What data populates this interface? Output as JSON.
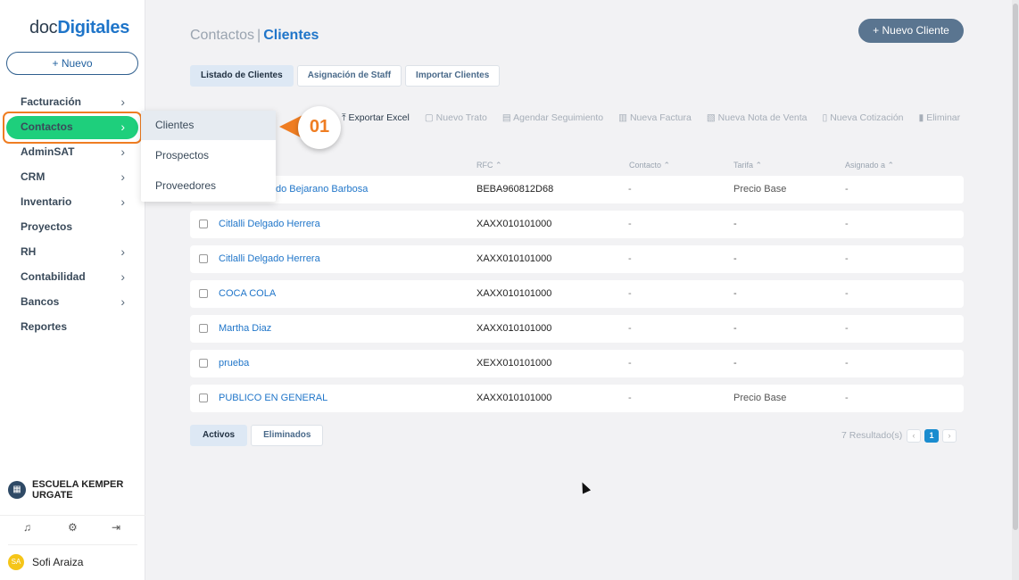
{
  "sidebar": {
    "logo_prefix": "doc",
    "logo_bold": "Digitales",
    "new_button": "+ Nuevo",
    "items": [
      {
        "label": "Facturación",
        "has_chevron": true
      },
      {
        "label": "Contactos",
        "has_chevron": true,
        "active": true
      },
      {
        "label": "AdminSAT",
        "has_chevron": true
      },
      {
        "label": "CRM",
        "has_chevron": true
      },
      {
        "label": "Inventario",
        "has_chevron": true
      },
      {
        "label": "Proyectos",
        "has_chevron": false
      },
      {
        "label": "RH",
        "has_chevron": true
      },
      {
        "label": "Contabilidad",
        "has_chevron": true
      },
      {
        "label": "Bancos",
        "has_chevron": true
      },
      {
        "label": "Reportes",
        "has_chevron": false
      }
    ],
    "chevron": "›",
    "org": {
      "icon": "building-icon",
      "name": "ESCUELA KEMPER URGATE"
    },
    "footer_icons": [
      "bell-icon",
      "gear-icon",
      "logout-icon"
    ],
    "user": {
      "initials": "SA",
      "name": "Sofi Araiza"
    }
  },
  "header": {
    "section": "Contactos",
    "separator": "|",
    "page": "Clientes",
    "new_client_button": "+ Nuevo Cliente"
  },
  "tabs": [
    "Listado de Clientes",
    "Asignación de Staff",
    "Importar Clientes"
  ],
  "toolbar": [
    "⤒ Exportar Excel",
    "▢ Nuevo Trato",
    "▤ Agendar Seguimiento",
    "▥ Nueva Factura",
    "▧ Nueva Nota de Venta",
    "▯ Nueva Cotización",
    "▮ Eliminar"
  ],
  "table": {
    "columns": [
      "RFC ⌃",
      "Contacto ⌃",
      "Tarifa ⌃",
      "Asignado a ⌃"
    ],
    "rows": [
      {
        "name": "do Bejarano Barbosa",
        "rfc": "BEBA960812D68",
        "contacto": "-",
        "tarifa": "Precio Base",
        "asignado": "-"
      },
      {
        "name": "Citlalli Delgado Herrera",
        "rfc": "XAXX010101000",
        "contacto": "-",
        "tarifa": "-",
        "asignado": "-"
      },
      {
        "name": "Citlalli Delgado Herrera",
        "rfc": "XAXX010101000",
        "contacto": "-",
        "tarifa": "-",
        "asignado": "-"
      },
      {
        "name": "COCA COLA",
        "rfc": "XAXX010101000",
        "contacto": "-",
        "tarifa": "-",
        "asignado": "-"
      },
      {
        "name": "Martha Diaz",
        "rfc": "XAXX010101000",
        "contacto": "-",
        "tarifa": "-",
        "asignado": "-"
      },
      {
        "name": "prueba",
        "rfc": "XEXX010101000",
        "contacto": "-",
        "tarifa": "-",
        "asignado": "-"
      },
      {
        "name": "PUBLICO EN GENERAL",
        "rfc": "XAXX010101000",
        "contacto": "-",
        "tarifa": "Precio Base",
        "asignado": "-"
      }
    ]
  },
  "bottom_tabs": [
    "Activos",
    "Eliminados"
  ],
  "results": "7 Resultado(s)",
  "pager": {
    "prev": "‹",
    "current": "1",
    "next": "›"
  },
  "dropdown": [
    "Clientes",
    "Prospectos",
    "Proveedores"
  ],
  "callout": "01",
  "colors": {
    "accent": "#1f75c9",
    "active_green": "#1ecf7c",
    "highlight_orange": "#ef7d22"
  }
}
